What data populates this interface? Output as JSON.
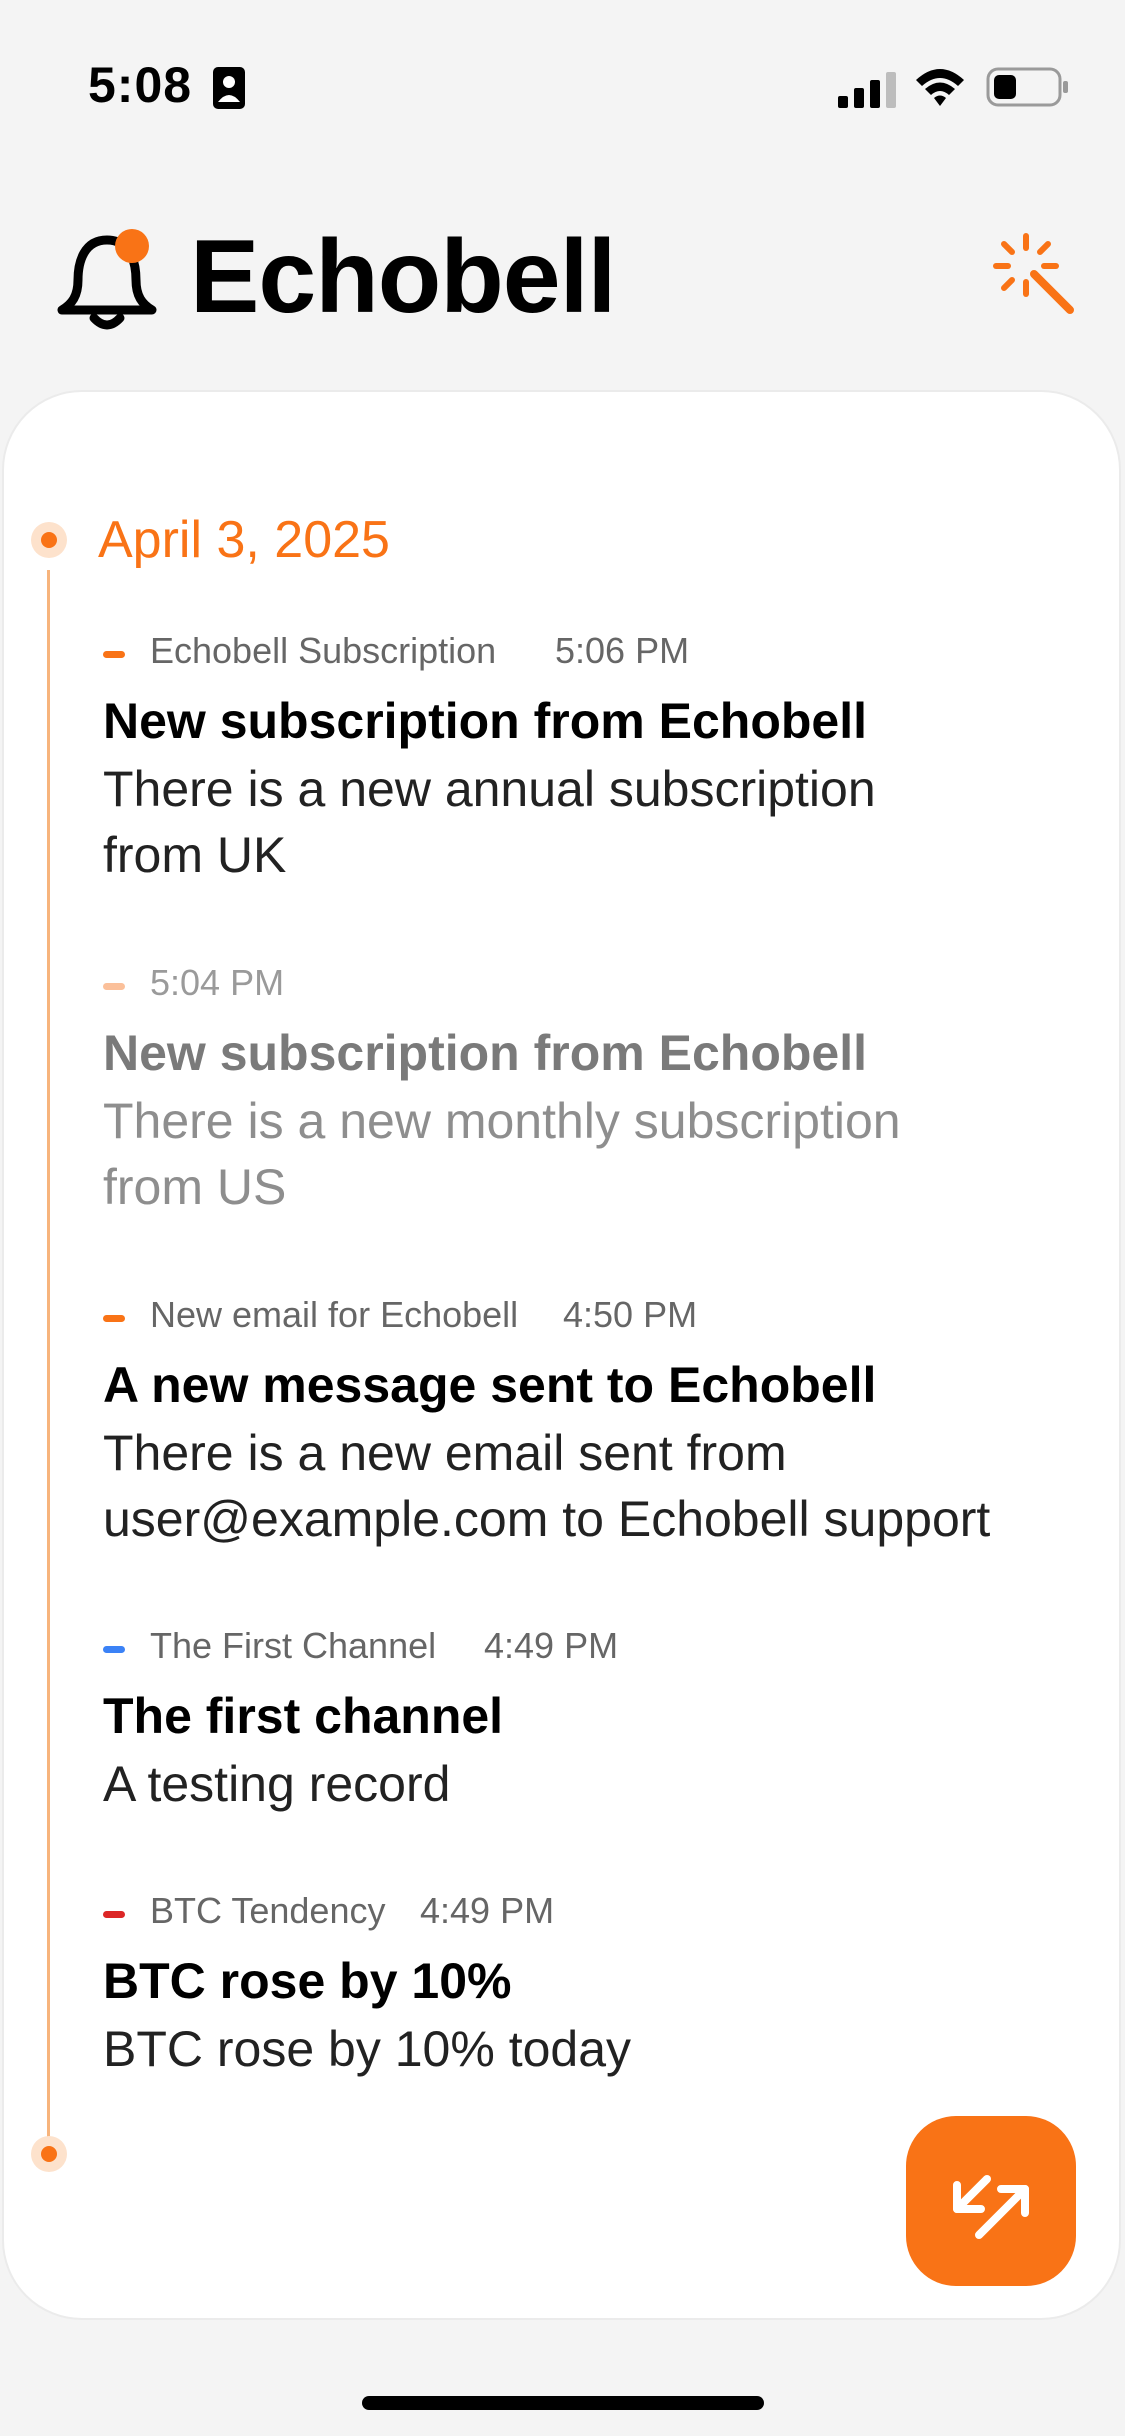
{
  "status_bar": {
    "time": "5:08"
  },
  "header": {
    "title": "Echobell"
  },
  "colors": {
    "accent": "#f97316",
    "orange_faded": "#fbc09a",
    "blue": "#3b82f6",
    "red": "#dc2626"
  },
  "timeline": {
    "date": "April 3, 2025",
    "items": [
      {
        "channel": "Echobell Subscription",
        "time": "5:06 PM",
        "title": "New subscription from Echobell",
        "body": "There is a new annual subscription from UK"
      },
      {
        "channel": "",
        "time": "5:04 PM",
        "title": "New subscription from Echobell",
        "body": "There is a new monthly subscription from US"
      },
      {
        "channel": "New email for Echobell",
        "time": "4:50 PM",
        "title": "A new message sent to Echobell",
        "body": "There is a new email sent from user@example.com to Echobell support"
      },
      {
        "channel": "The First Channel",
        "time": "4:49 PM",
        "title": "The first channel",
        "body": "A testing record"
      },
      {
        "channel": "BTC Tendency",
        "time": "4:49 PM",
        "title": "BTC rose by 10%",
        "body": "BTC rose by 10% today"
      }
    ]
  },
  "icons": {
    "logo": "bell-icon",
    "magic": "magic-wand-icon",
    "fab": "expand-arrows-icon"
  }
}
